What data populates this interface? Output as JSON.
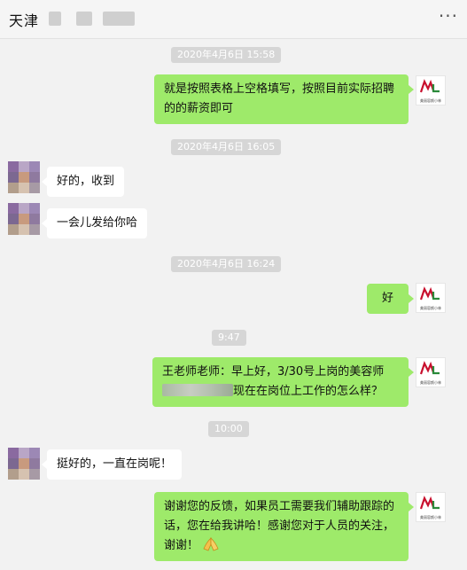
{
  "header": {
    "title": "天津",
    "more_icon": "more-dots-icon"
  },
  "colors": {
    "outgoing_bubble": "#9eea6a",
    "incoming_bubble": "#ffffff",
    "timestamp_bg": "#d6d6d6",
    "background": "#f2f2f2"
  },
  "contact_logo": {
    "caption": "美丽容颜小林"
  },
  "messages": {
    "ts1": "2020年4月6日 15:58",
    "m1": "就是按照表格上空格填写，按照目前实际招聘的的薪资即可",
    "ts2": "2020年4月6日 16:05",
    "m2": "好的，收到",
    "m3": "一会儿发给你哈",
    "ts3": "2020年4月6日 16:24",
    "m4": "好",
    "ts4": "9:47",
    "m5_part1": "王老师老师：早上好，3/30号上岗的美容师",
    "m5_part2": "现在在岗位上工作的怎么样？",
    "ts5": "10:00",
    "m6": "挺好的，一直在岗呢！",
    "m7": "谢谢您的反馈，如果员工需要我们辅助跟踪的话，您在给我讲哈！感谢您对于人员的关注，谢谢！",
    "m7_emoji": "folded-hands-emoji"
  }
}
